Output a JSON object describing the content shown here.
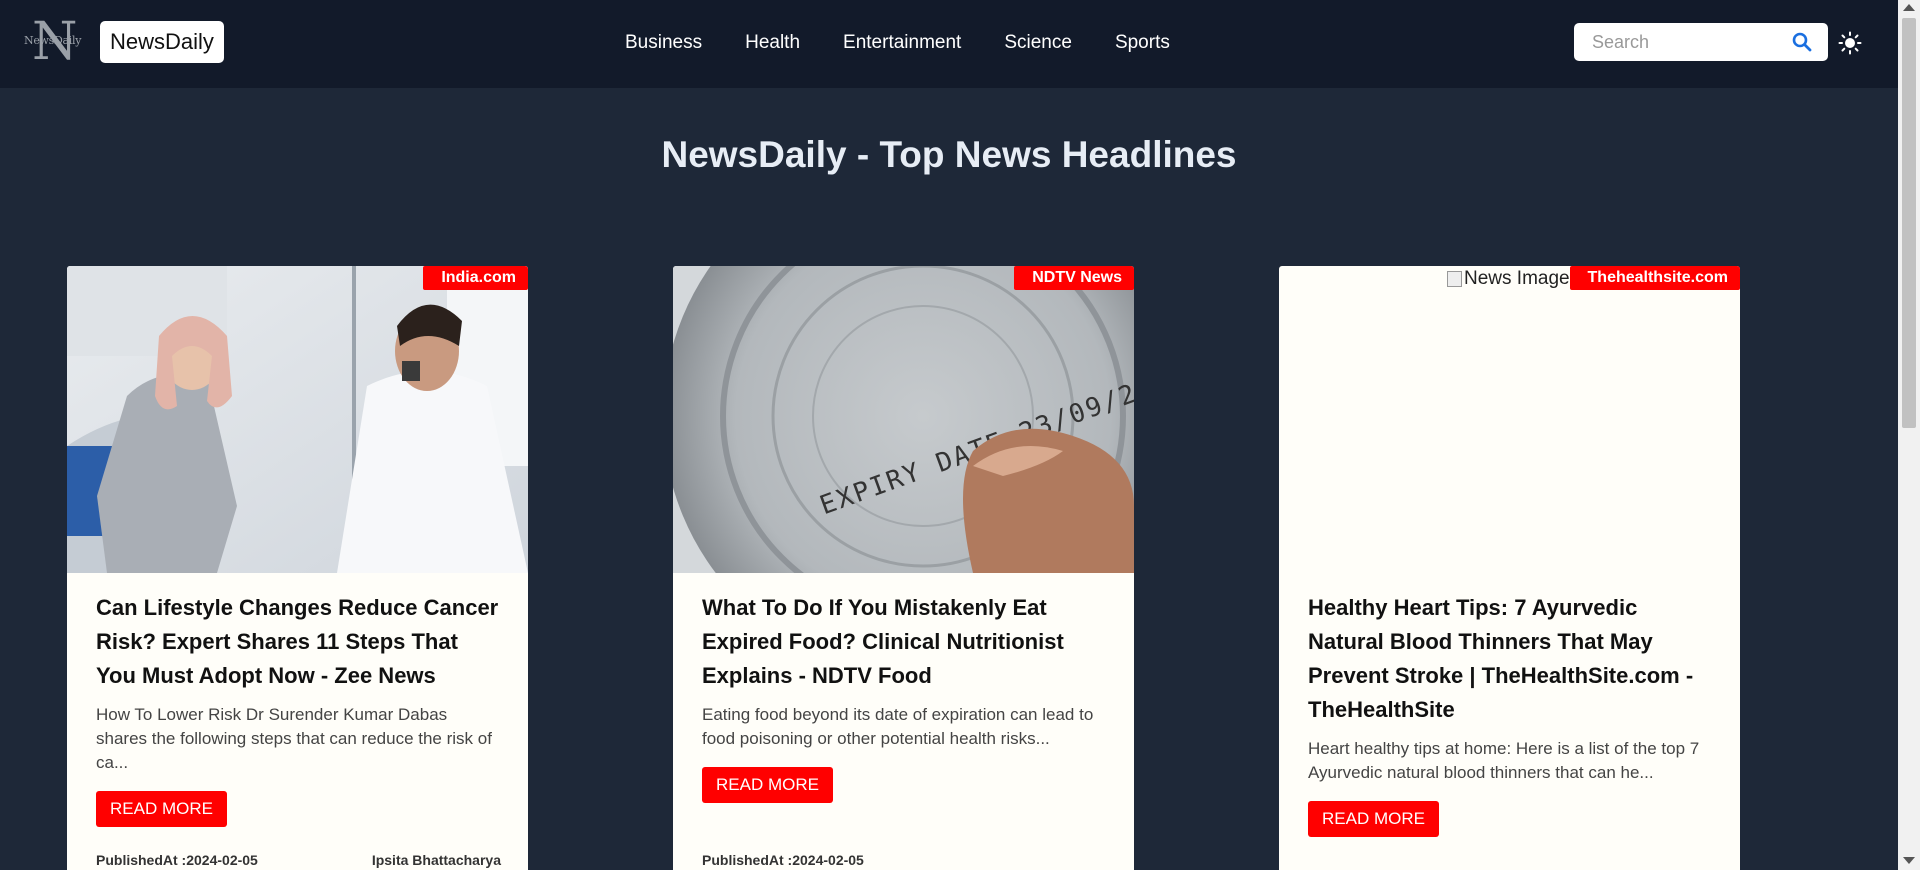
{
  "navbar": {
    "logo_letter": "N",
    "logo_small": "NewsDaily",
    "brand": "NewsDaily",
    "links": [
      "Business",
      "Health",
      "Entertainment",
      "Science",
      "Sports"
    ],
    "search_placeholder": "Search",
    "icons": [
      "search-icon",
      "sun-icon"
    ]
  },
  "page_heading": "NewsDaily - Top News Headlines",
  "cards": [
    {
      "source": "India.com",
      "title": "Can Lifestyle Changes Reduce Cancer Risk? Expert Shares 11 Steps That You Must Adopt Now - Zee News",
      "description": "How To Lower Risk  Dr Surender Kumar Dabas shares the following steps that can reduce the risk of ca...",
      "button": "READ MORE",
      "published": "PublishedAt :2024-02-05",
      "author": "Ipsita Bhattacharya",
      "image": "photo-patient-doctor"
    },
    {
      "source": "NDTV News",
      "title": "What To Do If You Mistakenly Eat Expired Food? Clinical Nutritionist Explains - NDTV Food",
      "description": "Eating food beyond its date of expiration can lead to food poisoning or other potential health risks...",
      "button": "READ MORE",
      "published": "PublishedAt :2024-02-05",
      "author": "",
      "image_text": "EXPIRY DATE 23/09/2",
      "image": "photo-expiry-can-lid"
    },
    {
      "source": "Thehealthsite.com",
      "title": "Healthy Heart Tips: 7 Ayurvedic Natural Blood Thinners That May Prevent Stroke | TheHealthSite.com - TheHealthSite",
      "description": "Heart healthy tips at home: Here is a list of the top 7 Ayurvedic natural blood thinners that can he...",
      "button": "READ MORE",
      "published": "",
      "author": "",
      "image_alt": "News Image",
      "image": "broken-image"
    }
  ],
  "colors": {
    "navbar_bg": "#121a2a",
    "page_bg": "#1e2838",
    "accent": "#ff0000",
    "card_bg": "#fffef9"
  }
}
